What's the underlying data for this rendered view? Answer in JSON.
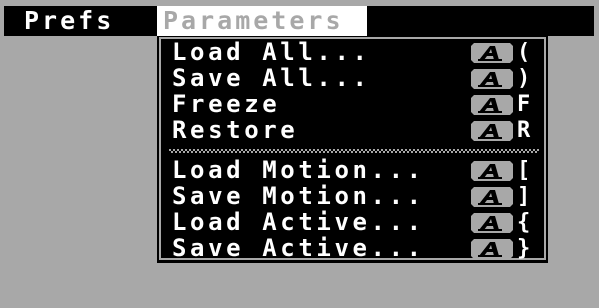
{
  "menubar": {
    "menus": [
      {
        "label": "Prefs"
      },
      {
        "label": "Parameters"
      }
    ]
  },
  "dropdown": {
    "groups": [
      [
        {
          "label": "Load All...",
          "shortcut": "("
        },
        {
          "label": "Save All...",
          "shortcut": ")"
        },
        {
          "label": "Freeze",
          "shortcut": "F"
        },
        {
          "label": "Restore",
          "shortcut": "R"
        }
      ],
      [
        {
          "label": "Load Motion...",
          "shortcut": "["
        },
        {
          "label": "Save Motion...",
          "shortcut": "]"
        },
        {
          "label": "Load Active...",
          "shortcut": "{"
        },
        {
          "label": "Save Active...",
          "shortcut": "}"
        }
      ]
    ],
    "shortcut_key_icon": "amiga-key-icon"
  },
  "colors": {
    "background": "#a8a8a8",
    "menubar": "#000000",
    "highlight": "#ffffff",
    "text": "#ffffff"
  }
}
